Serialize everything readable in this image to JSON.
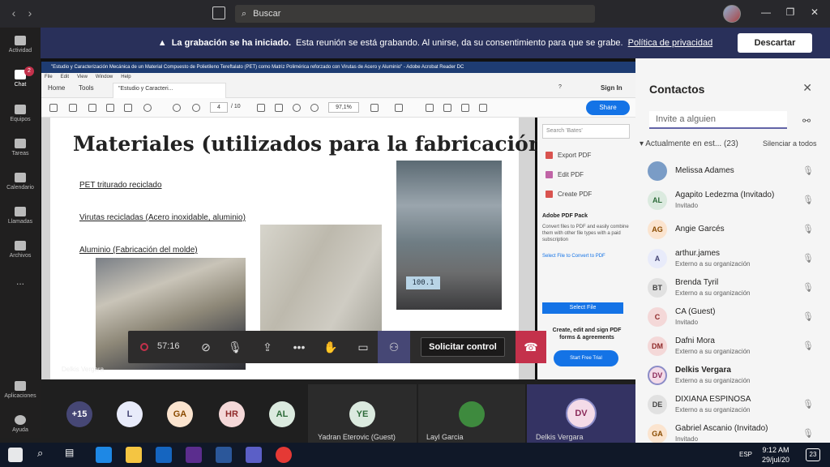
{
  "titlebar": {
    "search_placeholder": "Buscar"
  },
  "rail": {
    "items": [
      {
        "label": "Actividad",
        "icon": "bell-icon"
      },
      {
        "label": "Chat",
        "icon": "chat-icon",
        "badge": "2"
      },
      {
        "label": "Equipos",
        "icon": "teams-icon"
      },
      {
        "label": "Tareas",
        "icon": "tasks-icon"
      },
      {
        "label": "Calendario",
        "icon": "calendar-icon"
      },
      {
        "label": "Llamadas",
        "icon": "phone-icon"
      },
      {
        "label": "Archivos",
        "icon": "files-icon"
      },
      {
        "label": "...",
        "icon": "more-icon"
      },
      {
        "label": "Aplicaciones",
        "icon": "apps-icon"
      },
      {
        "label": "Ayuda",
        "icon": "help-icon"
      }
    ]
  },
  "banner": {
    "bold": "La grabación se ha iniciado.",
    "text": "Esta reunión se está grabando. Al unirse, da su consentimiento para que se grabe.",
    "link": "Política de privacidad",
    "button": "Descartar"
  },
  "acrobat": {
    "title": "\"Estudio y Caracterización Mecánica de un Material Compuesto de Polietileno Tereftalato (PET) como Matriz Polimérica reforzado con Virutas de Acero y Aluminio\" - Adobe Acrobat Reader DC",
    "menu": [
      "File",
      "Edit",
      "View",
      "Window",
      "Help"
    ],
    "tabs": {
      "home": "Home",
      "tools": "Tools",
      "doc": "\"Estudio y Caracteri...",
      "signin": "Sign In"
    },
    "page": "4",
    "total": "/ 10",
    "zoom": "97,1%",
    "share": "Share",
    "right": {
      "search": "Search 'Bates'",
      "tools": [
        "Export PDF",
        "Edit PDF",
        "Create PDF"
      ],
      "pack_title": "Adobe PDF Pack",
      "pack_text": "Convert files to PDF and easily combine them with other file types with a paid subscription",
      "pack_link": "Select File to Convert to PDF",
      "select": "Select File",
      "sign_text": "Create, edit and sign PDF forms & agreements",
      "trial": "Start Free Trial"
    }
  },
  "slide": {
    "title": "Materiales (utilizados para la fabricación)",
    "items": [
      "PET triturado reciclado",
      "Virutas recicladas (Acero inoxidable, aluminio)",
      "Aluminio (Fabricación del molde)"
    ],
    "scale_readout": "100.1",
    "presenter": "Delkis Vergara"
  },
  "callbar": {
    "timer": "57:16",
    "request_control": "Solicitar control"
  },
  "strip": {
    "bubbles": [
      {
        "initials": "+15",
        "bg": "#464775",
        "fg": "#ffffff"
      },
      {
        "initials": "L",
        "bg": "#e8ebfa",
        "fg": "#464775"
      },
      {
        "initials": "GA",
        "bg": "#fbe4cf",
        "fg": "#8a4b00"
      },
      {
        "initials": "HR",
        "bg": "#f4d8d8",
        "fg": "#8f2a2a"
      },
      {
        "initials": "AL",
        "bg": "#dbeadf",
        "fg": "#2d6b3a"
      }
    ],
    "tiles": [
      {
        "initials": "YE",
        "name": "Yadran Eterovic (Guest)"
      },
      {
        "initials": "",
        "name": "Layl Garcia"
      },
      {
        "initials": "DV",
        "name": "Delkis Vergara"
      }
    ]
  },
  "panel": {
    "title": "Contactos",
    "invite_placeholder": "Invite a alguien",
    "section": "Actualmente en est...",
    "count": "(23)",
    "mute_all": "Silenciar a todos",
    "people": [
      {
        "initials": "",
        "name": "Melissa Adames",
        "sub": "",
        "bg": "#7a9cc6",
        "fg": "#fff"
      },
      {
        "initials": "AL",
        "name": "Agapito Ledezma (Invitado)",
        "sub": "Invitado",
        "bg": "#dbeadf",
        "fg": "#2d6b3a"
      },
      {
        "initials": "AG",
        "name": "Angie Garcés",
        "sub": "",
        "bg": "#fbe4cf",
        "fg": "#8a4b00"
      },
      {
        "initials": "A",
        "name": "arthur.james",
        "sub": "Externo a su organización",
        "bg": "#e8ebfa",
        "fg": "#464775"
      },
      {
        "initials": "BT",
        "name": "Brenda Tyril",
        "sub": "Externo a su organización",
        "bg": "#e1e1e1",
        "fg": "#444"
      },
      {
        "initials": "C",
        "name": "CA (Guest)",
        "sub": "Invitado",
        "bg": "#f4d8d8",
        "fg": "#8f2a2a"
      },
      {
        "initials": "DM",
        "name": "Dafni Mora",
        "sub": "Externo a su organización",
        "bg": "#f4d8d8",
        "fg": "#8f2a2a"
      },
      {
        "initials": "DV",
        "name": "Delkis Vergara",
        "sub": "Externo a su organización",
        "bg": "#f4dbe8",
        "fg": "#8a2a5a"
      },
      {
        "initials": "DE",
        "name": "DIXIANA ESPINOSA",
        "sub": "Externo a su organización",
        "bg": "#e1e1e1",
        "fg": "#444"
      },
      {
        "initials": "GA",
        "name": "Gabriel Ascanio (Invitado)",
        "sub": "Invitado",
        "bg": "#fbe4cf",
        "fg": "#8a4b00"
      }
    ]
  },
  "taskbar": {
    "lang": "ESP",
    "time": "9:12 AM",
    "date": "29/jul/20",
    "notif": "23"
  }
}
